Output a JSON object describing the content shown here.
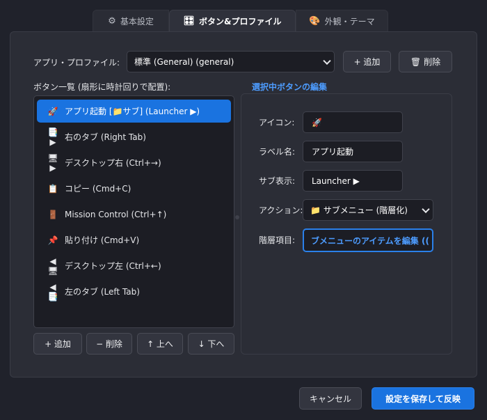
{
  "tabs": [
    {
      "icon": "⚙",
      "label": "基本設定"
    },
    {
      "icon": "🎛",
      "label": "ボタン&プロファイル"
    },
    {
      "icon": "🎨",
      "label": "外観・テーマ"
    }
  ],
  "profile": {
    "label": "アプリ・プロファイル:",
    "selected": "標準 (General) (general)",
    "add_label": "+ 追加",
    "delete_icon": "🗑",
    "delete_label": "削除"
  },
  "button_list": {
    "title": "ボタン一覧 (扇形に時計回りで配置):",
    "items": [
      {
        "icon": "🚀",
        "label": "アプリ起動 [📁サブ] (Launcher ▶)",
        "selected": true
      },
      {
        "icon": "📑▶",
        "label": "右のタブ (Right Tab)"
      },
      {
        "icon": "🖥▶",
        "label": "デスクトップ右 (Ctrl+→)"
      },
      {
        "icon": "📋",
        "label": "コピー (Cmd+C)"
      },
      {
        "icon": "🚪",
        "label": "Mission Control (Ctrl+↑)"
      },
      {
        "icon": "📌",
        "label": "貼り付け (Cmd+V)"
      },
      {
        "icon": "◀🖥",
        "label": "デスクトップ左 (Ctrl+←)"
      },
      {
        "icon": "◀📑",
        "label": "左のタブ (Left Tab)"
      }
    ],
    "add_label": "+ 追加",
    "remove_label": "− 削除",
    "up_label": "↑ 上へ",
    "down_label": "↓ 下へ"
  },
  "editor": {
    "title": "選択中ボタンの編集",
    "icon_label": "アイコン:",
    "icon_value": "🚀",
    "name_label": "ラベル名:",
    "name_value": "アプリ起動",
    "sub_label": "サブ表示:",
    "sub_value": "Launcher ▶",
    "action_label": "アクション:",
    "action_value": "📁 サブメニュー (階層化)",
    "hierarchy_label": "階層項目:",
    "hierarchy_button": "ブメニューのアイテムを編集 (("
  },
  "footer": {
    "cancel_label": "キャンセル",
    "save_label": "設定を保存して反映"
  },
  "colors": {
    "accent": "#1a73e0",
    "background": "#20222b",
    "panel": "#2b2d36",
    "link": "#4d9cff"
  }
}
